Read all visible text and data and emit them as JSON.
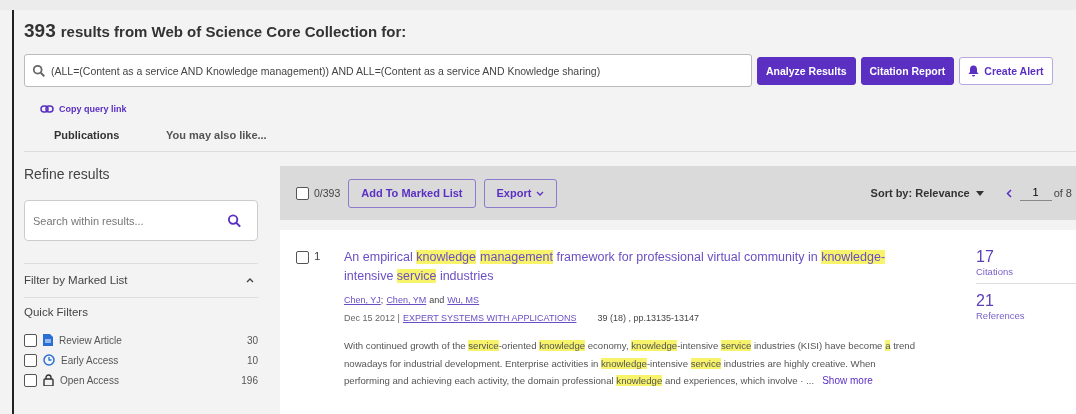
{
  "header": {
    "count": "393",
    "text": "results from Web of Science Core Collection for:"
  },
  "query": {
    "value": "(ALL=(Content as a service AND Knowledge management)) AND ALL=(Content as a service AND Knowledge sharing)"
  },
  "actions": [
    {
      "label": "Analyze Results",
      "kind": "primary"
    },
    {
      "label": "Citation Report",
      "kind": "primary"
    },
    {
      "label": "Create Alert",
      "kind": "alert"
    }
  ],
  "copy_link": "Copy query link",
  "tabs": [
    {
      "label": "Publications",
      "selected": true
    },
    {
      "label": "You may also like...",
      "selected": false
    }
  ],
  "sidebar": {
    "title": "Refine results",
    "search": {
      "placeholder": "Search within results..."
    },
    "marked_list": {
      "label": "Filter by Marked List",
      "expanded": true
    },
    "quick_filters": {
      "title": "Quick Filters",
      "items": [
        {
          "label": "Review Article",
          "count": "30",
          "checked": false,
          "kind": "document"
        },
        {
          "label": "Early Access",
          "count": "10",
          "checked": false,
          "kind": "clock"
        },
        {
          "label": "Open Access",
          "count": "196",
          "checked": false,
          "kind": "lock"
        }
      ]
    }
  },
  "toolbar": {
    "select_all": {
      "label": "0/393",
      "checked": false
    },
    "add_to_list": "Add To Marked List",
    "export": "Export",
    "sort": "Sort by: Relevance",
    "page": {
      "value": "1",
      "of": "of 8"
    }
  },
  "results": [
    {
      "number": "1",
      "checked": false,
      "title": [
        {
          "text": "An empirical ",
          "highlighted": false
        },
        {
          "text": "knowledge",
          "highlighted": true
        },
        {
          "text": "management",
          "highlighted": true,
          "gap_before": true
        },
        {
          "text": " framework for professional virtual community in ",
          "highlighted": false
        },
        {
          "text": "knowledge-",
          "highlighted": true
        },
        {
          "text": " intensive ",
          "highlighted": false
        },
        {
          "text": "service",
          "highlighted": true
        },
        {
          "text": " industries",
          "highlighted": false
        }
      ],
      "authors": [
        "Chen, YJ",
        "Chen, YM",
        "Wu, MS"
      ],
      "author_and": "and",
      "author_sep": ";",
      "date": "Dec 15 2012 |",
      "journal": "EXPERT SYSTEMS WITH APPLICATIONS",
      "pages": "39 (18) , pp.13135-13147",
      "abstract": [
        [
          {
            "text": "With continued growth of the ",
            "highlighted": false
          },
          {
            "text": "service",
            "highlighted": true
          },
          {
            "text": "-oriented ",
            "highlighted": false
          },
          {
            "text": "knowledge",
            "highlighted": true
          },
          {
            "text": " economy, ",
            "highlighted": false
          },
          {
            "text": "knowledge",
            "highlighted": true
          },
          {
            "text": "-intensive ",
            "highlighted": false
          },
          {
            "text": "service",
            "highlighted": true
          },
          {
            "text": " industries (KISI) have become ",
            "highlighted": false
          },
          {
            "text": "a",
            "highlighted": true
          },
          {
            "text": " trend",
            "highlighted": false
          }
        ],
        [
          {
            "text": "nowadays for industrial development. Enterprise activities in ",
            "highlighted": false
          },
          {
            "text": "knowledge",
            "highlighted": true
          },
          {
            "text": "-intensive ",
            "highlighted": false
          },
          {
            "text": "service",
            "highlighted": true
          },
          {
            "text": " industries are highly creative. When",
            "highlighted": false
          }
        ],
        [
          {
            "text": "performing and achieving each activity, the domain professional ",
            "highlighted": false
          },
          {
            "text": "knowledge",
            "highlighted": true
          },
          {
            "text": " and experiences, which involve · ...",
            "highlighted": false
          }
        ]
      ],
      "show_more": "Show more",
      "metrics": [
        {
          "value": "17",
          "label": "Citations"
        },
        {
          "value": "21",
          "label": "References"
        }
      ]
    }
  ]
}
